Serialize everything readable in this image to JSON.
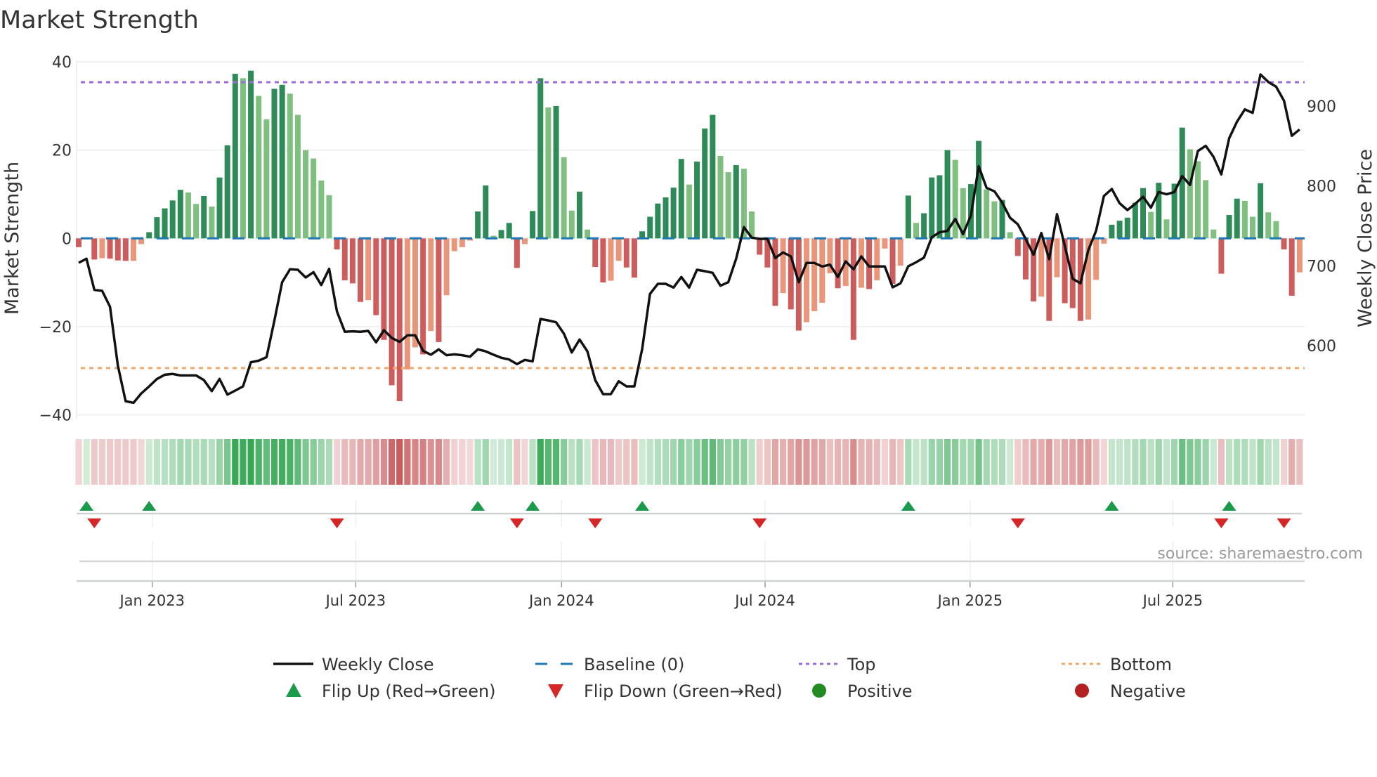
{
  "title": "Market Strength",
  "source": "source: sharemaestro.com",
  "chart_data": {
    "type": "bar",
    "title": "Market Strength",
    "ylabel": "Market Strength",
    "y2label": "Weekly Close Price",
    "ylim": [
      -40,
      40
    ],
    "y_ticks": [
      "40",
      "20",
      "0",
      "−20",
      "−40"
    ],
    "y_tick_values": [
      40,
      20,
      0,
      -20,
      -40
    ],
    "y2_ticks": [
      "900",
      "800",
      "700",
      "600"
    ],
    "y2_tick_values": [
      900,
      800,
      700,
      600
    ],
    "x_ticks": [
      "Jan 2023",
      "Jul 2023",
      "Jan 2024",
      "Jul 2024",
      "Jan 2025",
      "Jul 2025"
    ],
    "x_tick_week_index": [
      9.4,
      35.4,
      61.7,
      87.7,
      113.9,
      139.8
    ],
    "top_level": 35.4,
    "bottom_level": -29.4,
    "baseline": 0,
    "colors": {
      "pos_strong": "#2e8b57",
      "pos_weak": "#7fbf7f",
      "neg_strong": "#cd5c5c",
      "neg_weak": "#e9967a",
      "baseline": "#1f77b4",
      "top": "#9b6bdc",
      "bottom": "#f0a868",
      "flip_up": "#1a9a4a",
      "flip_down": "#d62728",
      "positive": "#228b22",
      "negative": "#b22222",
      "close": "#111111"
    },
    "strength": [
      -2,
      0.2,
      -4.8,
      -4.5,
      -4.6,
      -5,
      -5.1,
      -5.1,
      -1.3,
      1.4,
      4.8,
      6.8,
      8.6,
      11,
      10.4,
      7.8,
      9.6,
      7.2,
      13.8,
      21.1,
      37.3,
      36.3,
      38,
      32.3,
      27,
      33.9,
      34.8,
      32.8,
      28,
      20,
      18.1,
      13.1,
      9.8,
      -2.5,
      -9.5,
      -10.2,
      -14.4,
      -14,
      -17.4,
      -23,
      -33.3,
      -36.9,
      -29.7,
      -24.7,
      -26.3,
      -21,
      -23.5,
      -12.9,
      -2.9,
      -2,
      -0.5,
      6.1,
      12,
      0.6,
      1.9,
      3.5,
      -6.7,
      -1.3,
      6.2,
      36.3,
      29.7,
      30,
      18.4,
      6.3,
      10.6,
      2,
      -6.5,
      -10,
      -9.6,
      -5.1,
      -6.6,
      -8.9,
      1.6,
      4.9,
      7.9,
      9.3,
      11.5,
      18,
      12.2,
      17.4,
      24.9,
      28,
      18.7,
      15,
      16.6,
      15.8,
      6.1,
      -3.7,
      -6.6,
      -15.3,
      -12.4,
      -16.1,
      -20.9,
      -19,
      -16.5,
      -14.6,
      -7.9,
      -11.3,
      -10.8,
      -23,
      -11.2,
      -11.5,
      -9.5,
      -2.3,
      -10.3,
      -6.2,
      9.7,
      3.5,
      5.7,
      13.8,
      14.3,
      20,
      17.8,
      11.4,
      12.3,
      22.1,
      11.1,
      8.4,
      8.7,
      1.4,
      -4,
      -9.3,
      -14.3,
      -13.2,
      -18.7,
      -8.8,
      -14.7,
      -15.8,
      -18.7,
      -18.4,
      -9.4,
      -1.2,
      3.1,
      4,
      4.7,
      8.1,
      11.4,
      6,
      12.6,
      4.3,
      12.4,
      25.1,
      20.2,
      17.5,
      13.2,
      2,
      -8,
      5.3,
      9,
      8.5,
      4.9,
      12.5,
      5.9,
      3.9,
      -2.5,
      -13,
      -7.7
    ],
    "shade": "DDDLDDDLLDDDDDLLDLDDDLDLLDDLLLLLLDDDDLDDDDLLDLDLLLLDDLDDDLDDLDLLDLDDLLDDDDDDDDLDDDLLDLLDDDLDDLLLLDLDLDLLDLDLDDDDLLDDLLDLDDDLDLDDDLLLDDDDDLDLDDLLLLDDDLLDLLDDL",
    "weekly_close": [
      703.9,
      708.9,
      669.9,
      668.7,
      648.8,
      575.5,
      530.6,
      528.5,
      540.3,
      549.1,
      558.4,
      563.7,
      564.6,
      562.8,
      562.8,
      562.8,
      557,
      543.2,
      558.4,
      538.8,
      543.8,
      549.1,
      579.3,
      581.3,
      585.7,
      631.2,
      679.5,
      695.7,
      695.1,
      685.4,
      692.1,
      676,
      696.2,
      642.9,
      617.4,
      618,
      617.4,
      618.6,
      604.2,
      619.4,
      609.8,
      604.8,
      613,
      613,
      593.7,
      588.7,
      595.4,
      588.1,
      589.2,
      588.1,
      586.3,
      595.4,
      593,
      588.7,
      584.9,
      582.8,
      577,
      582.2,
      580.5,
      633.5,
      631.7,
      629.4,
      615,
      591.6,
      607.7,
      593,
      557,
      539.4,
      539.4,
      555.5,
      549.1,
      549.1,
      596,
      664.9,
      677.5,
      677.5,
      672.8,
      686,
      672.8,
      695.1,
      693.3,
      691.3,
      675.1,
      679.5,
      708.9,
      748.5,
      735.3,
      733.8,
      733.8,
      709.8,
      716.8,
      711.8,
      679.5,
      703.6,
      703.6,
      699.2,
      701.5,
      686,
      705.6,
      695.7,
      711.8,
      699.2,
      699.2,
      699.2,
      673.1,
      678.1,
      699.5,
      704.5,
      710.3,
      735.8,
      742,
      743.7,
      758.7,
      739.7,
      763.1,
      824.6,
      797.7,
      793.3,
      779.2,
      760.2,
      752,
      733.8,
      713.8,
      741.1,
      708.3,
      764.6,
      725,
      683.9,
      678.1,
      719.7,
      744.1,
      787.4,
      796.2,
      778.4,
      769.8,
      777.7,
      786.5,
      772.8,
      792.4,
      789.5,
      792.4,
      812.3,
      801.2,
      843.7,
      850.2,
      836.4,
      814.4,
      859.8,
      880.4,
      895.9,
      891.5,
      939.6,
      930.2,
      924.3,
      906.8,
      862.8,
      870.7
    ],
    "flip_up_week_index": [
      1,
      9,
      51,
      58,
      72,
      106,
      132,
      147
    ],
    "flip_down_week_index": [
      2,
      33,
      56,
      66,
      87,
      120,
      146,
      154
    ],
    "legend": [
      {
        "label": "Weekly Close",
        "kind": "line"
      },
      {
        "label": "Baseline (0)",
        "kind": "dash"
      },
      {
        "label": "Top",
        "kind": "dot-top"
      },
      {
        "label": "Bottom",
        "kind": "dot-bottom"
      },
      {
        "label": "Flip Up (Red→Green)",
        "kind": "tri-up"
      },
      {
        "label": "Flip Down (Green→Red)",
        "kind": "tri-down"
      },
      {
        "label": "Positive",
        "kind": "dot-pos"
      },
      {
        "label": "Negative",
        "kind": "dot-neg"
      }
    ],
    "legend_placement": "bottom"
  }
}
